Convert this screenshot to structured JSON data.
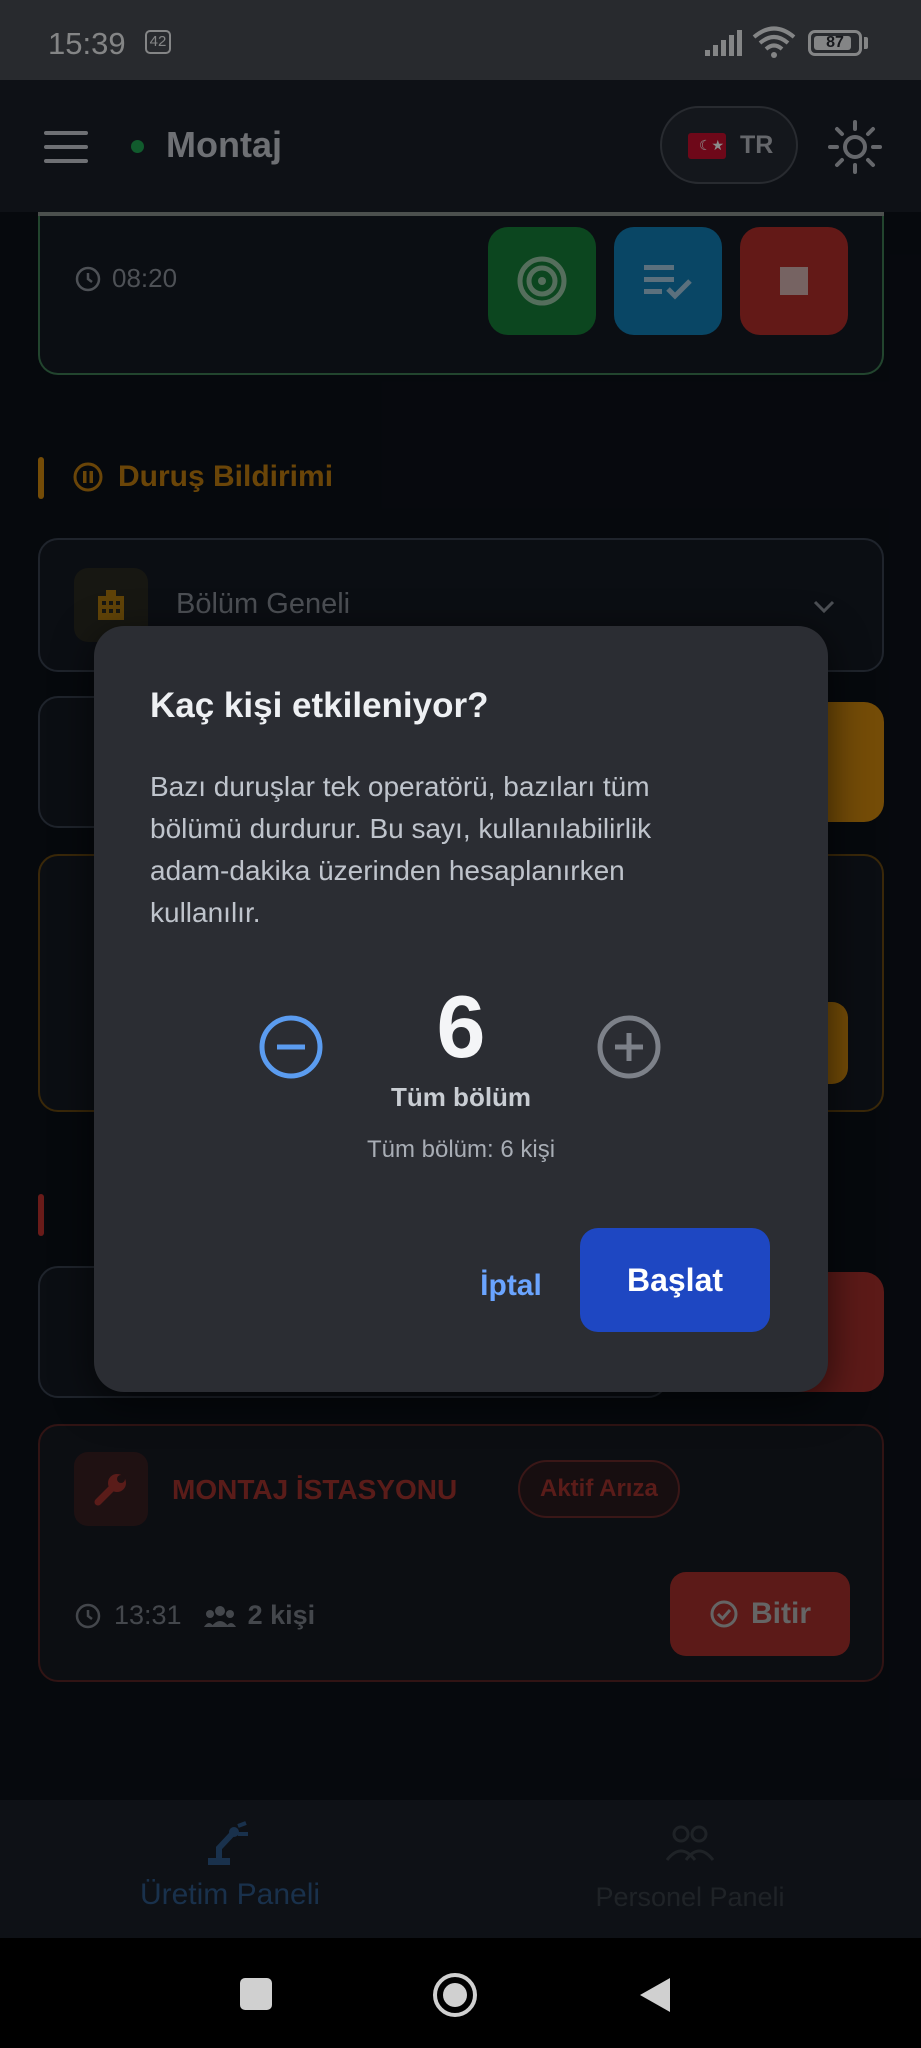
{
  "status_bar": {
    "time": "15:39",
    "notification_count": "42",
    "battery": "87",
    "battery_level": 0.87
  },
  "header": {
    "title": "Montaj",
    "language": "TR"
  },
  "card": {
    "time": "08:20"
  },
  "downtime_section": {
    "title": "Duruş Bildirimi",
    "select_value": "Bölüm Geneli"
  },
  "fault_card": {
    "title": "MONTAJ İSTASYONU",
    "badge": "Aktif Arıza",
    "time": "13:31",
    "people": "2 kişi",
    "finish_label": "Bitir"
  },
  "bottom_nav": {
    "production": "Üretim Paneli",
    "personnel": "Personel Paneli"
  },
  "dialog": {
    "title": "Kaç kişi etkileniyor?",
    "body": "Bazı duruşlar tek operatörü, bazıları tüm bölümü durdurur. Bu sayı, kullanılabilirlik adam-dakika üzerinden hesaplanırken kullanılır.",
    "count": "6",
    "count_label": "Tüm bölüm",
    "count_summary": "Tüm bölüm: 6 kişi",
    "cancel_label": "İptal",
    "start_label": "Başlat"
  },
  "colors": {
    "accent_blue": "#1e47c2",
    "link_blue": "#6aa4ff",
    "warning": "#d48a0d",
    "danger": "#a8302c",
    "success": "#1fa653"
  }
}
